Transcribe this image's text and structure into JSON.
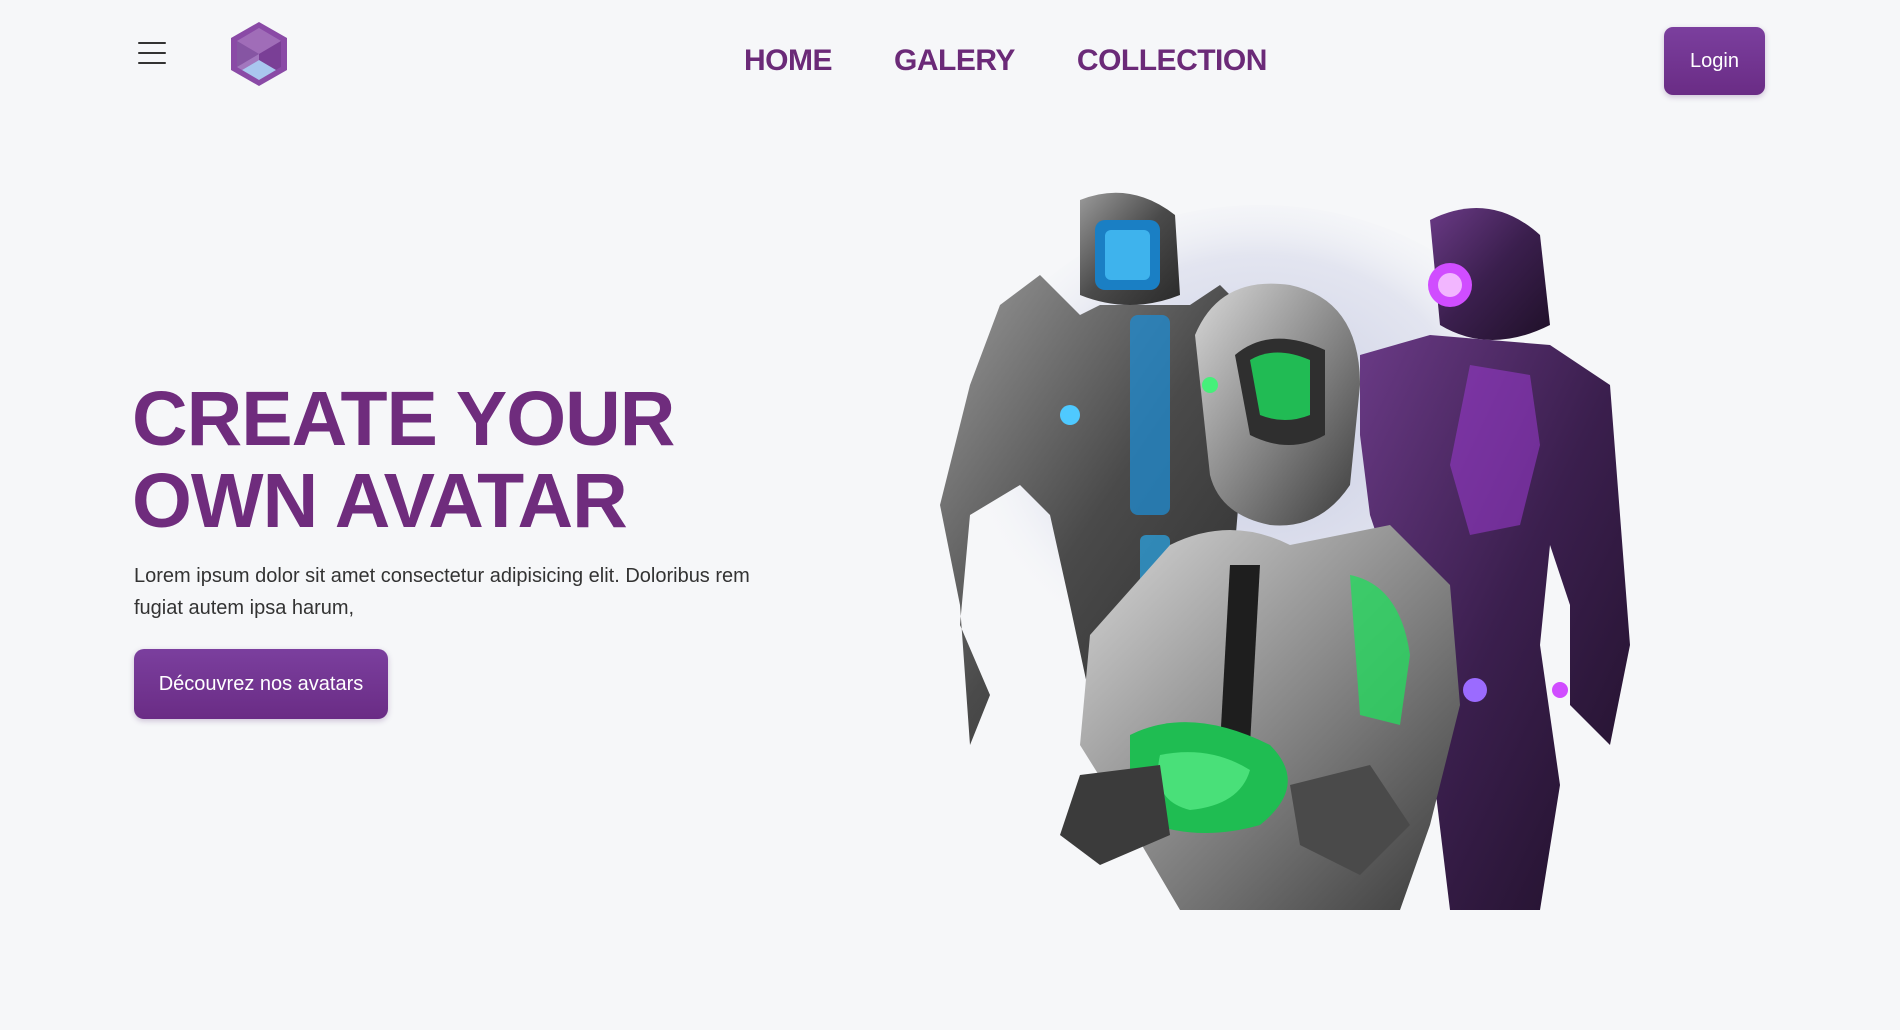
{
  "header": {
    "menu_icon": "hamburger-icon",
    "logo_icon": "hexagon-cube-logo",
    "nav": [
      {
        "label": "HOME"
      },
      {
        "label": "GALERY"
      },
      {
        "label": "COLLECTION"
      }
    ],
    "login_label": "Login"
  },
  "hero": {
    "title_line1": "CREATE YOUR",
    "title_line2": "OWN AVATAR",
    "description": "Lorem ipsum dolor sit amet consectetur adipisicing elit. Doloribus rem fugiat autem ipsa harum,",
    "cta_label": "Découvrez nos avatars",
    "image": "three-robot-avatars-illustration"
  },
  "colors": {
    "background": "#f6f7f9",
    "primary": "#6f2c7d",
    "button": "#74359a",
    "text": "#333333"
  }
}
